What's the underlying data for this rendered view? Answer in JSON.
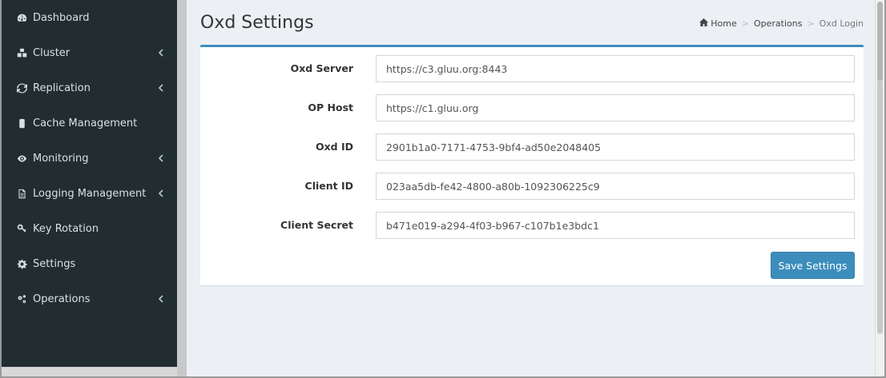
{
  "sidebar": {
    "items": [
      {
        "label": "Dashboard",
        "icon": "dashboard-icon",
        "has_submenu": false
      },
      {
        "label": "Cluster",
        "icon": "cubes-icon",
        "has_submenu": true
      },
      {
        "label": "Replication",
        "icon": "refresh-icon",
        "has_submenu": true
      },
      {
        "label": "Cache Management",
        "icon": "database-icon",
        "has_submenu": false
      },
      {
        "label": "Monitoring",
        "icon": "eye-icon",
        "has_submenu": true
      },
      {
        "label": "Logging Management",
        "icon": "file-text-icon",
        "has_submenu": true
      },
      {
        "label": "Key Rotation",
        "icon": "key-icon",
        "has_submenu": false
      },
      {
        "label": "Settings",
        "icon": "gear-icon",
        "has_submenu": false
      },
      {
        "label": "Operations",
        "icon": "gears-icon",
        "has_submenu": true
      }
    ]
  },
  "header": {
    "title": "Oxd Settings",
    "breadcrumb": {
      "home": "Home",
      "section": "Operations",
      "current": "Oxd Login"
    }
  },
  "form": {
    "fields": [
      {
        "label": "Oxd Server",
        "value": "https://c3.gluu.org:8443"
      },
      {
        "label": "OP Host",
        "value": "https://c1.gluu.org"
      },
      {
        "label": "Oxd ID",
        "value": "2901b1a0-7171-4753-9bf4-ad50e2048405"
      },
      {
        "label": "Client ID",
        "value": "023aa5db-fe42-4800-a80b-1092306225c9"
      },
      {
        "label": "Client Secret",
        "value": "b471e019-a294-4f03-b967-c107b1e3bdc1"
      }
    ],
    "save_label": "Save Settings"
  },
  "colors": {
    "sidebar_bg": "#222d32",
    "accent": "#3c8dbc",
    "content_bg": "#ecf0f5"
  }
}
